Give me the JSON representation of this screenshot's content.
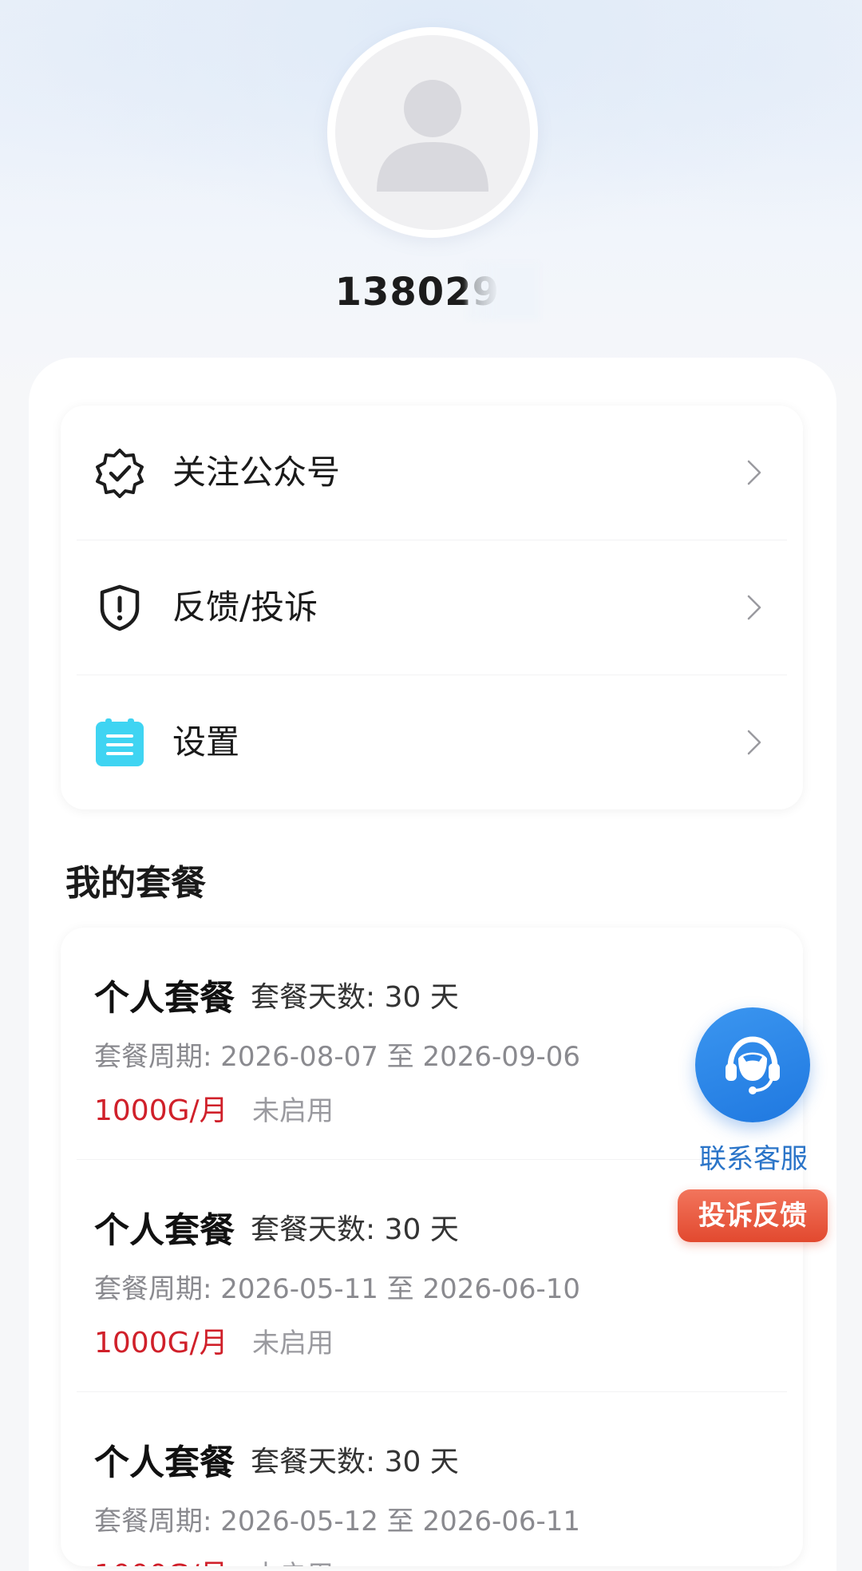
{
  "profile": {
    "phone": "1380298",
    "avatar_icon": "user-avatar-placeholder-icon"
  },
  "menu": [
    {
      "label": "关注公众号",
      "icon": "verified-badge-icon"
    },
    {
      "label": "反馈/投诉",
      "icon": "shield-alert-icon"
    },
    {
      "label": "设置",
      "icon": "clipboard-list-icon"
    }
  ],
  "plans_section": {
    "title": "我的套餐"
  },
  "plans": [
    {
      "name": "个人套餐",
      "days": "套餐天数:  30 天",
      "period": "套餐周期: 2026-08-07 至 2026-09-06",
      "data": "1000G/月",
      "status": "未启用"
    },
    {
      "name": "个人套餐",
      "days": "套餐天数:  30 天",
      "period": "套餐周期: 2026-05-11 至 2026-06-10",
      "data": "1000G/月",
      "status": "未启用"
    },
    {
      "name": "个人套餐",
      "days": "套餐天数:  30 天",
      "period": "套餐周期: 2026-05-12 至 2026-06-11",
      "data": "1000G/月",
      "status": "未启用"
    }
  ],
  "floating": {
    "customer_service_label": "联系客服",
    "customer_service_icon": "headset-icon",
    "complaint_label": "投诉反馈"
  },
  "colors": {
    "accent_blue": "#1f78e0",
    "data_red": "#d0202a",
    "complaint_orange": "#e2492f",
    "settings_icon_cyan": "#3fd4f2"
  }
}
